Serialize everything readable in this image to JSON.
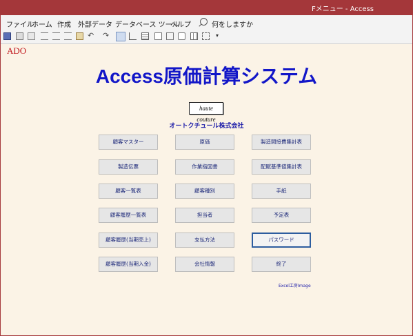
{
  "window": {
    "title": "Fメニュー  -  Access"
  },
  "menu": {
    "items": [
      "ファイル",
      "ホーム",
      "作成",
      "外部データ",
      "データベース ツール",
      "ヘルプ"
    ],
    "search_label": "何をしますか"
  },
  "toolbar": {
    "icons": [
      "save-icon",
      "print-preview-icon",
      "spelling-icon",
      "align-left-icon",
      "align-center-icon",
      "align-right-icon",
      "paste-icon",
      "undo-icon",
      "redo-icon",
      "form-view-icon",
      "design-view-icon",
      "datasheet-icon",
      "report-icon",
      "query-icon",
      "find-icon",
      "table-icon",
      "properties-icon",
      "customize-icon"
    ]
  },
  "form": {
    "ado_label": "ADO",
    "title": "Access原価計算システム",
    "logo_text": "haute couture",
    "company": "オートクチュール株式会社",
    "buttons": [
      "顧客マスター",
      "原価",
      "製造間接費集計表",
      "製造伝票",
      "作業指図書",
      "配賦基準値集計表",
      "顧客一覧表",
      "顧客種別",
      "手紙",
      "顧客履歴一覧表",
      "担当者",
      "予定表",
      "顧客履歴(当期売上)",
      "支払方法",
      "パスワード",
      "顧客履歴(当期入金)",
      "会社情報",
      "終了"
    ],
    "focused_button": "パスワード",
    "credit": "Excel工房Image"
  },
  "colors": {
    "title_bar": "#a4373a",
    "form_bg": "#fbf3e6",
    "title_text": "#1216c8",
    "ado_text": "#c0161c"
  }
}
